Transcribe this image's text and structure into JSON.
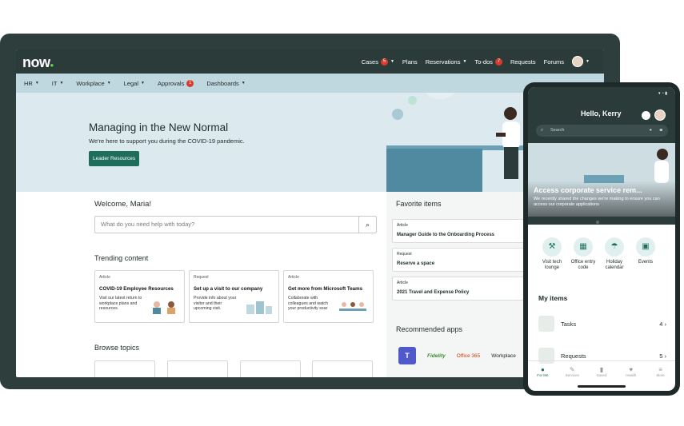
{
  "portal": {
    "logo": "now",
    "topnav": [
      {
        "label": "Cases",
        "badge": "5"
      },
      {
        "label": "Plans"
      },
      {
        "label": "Reservations"
      },
      {
        "label": "To-dos",
        "badge": "7"
      },
      {
        "label": "Requests"
      },
      {
        "label": "Forums"
      }
    ],
    "subnav": [
      {
        "label": "HR"
      },
      {
        "label": "IT"
      },
      {
        "label": "Workplace"
      },
      {
        "label": "Legal"
      },
      {
        "label": "Approvals",
        "badge": "1"
      },
      {
        "label": "Dashboards"
      }
    ],
    "hero": {
      "title": "Managing in the New Normal",
      "subtitle": "We're here to support you during the COVID-19 pandemic.",
      "button": "Leader Resources"
    },
    "welcome": "Welcome, Maria!",
    "search_placeholder": "What do you need help with today?",
    "trending_title": "Trending content",
    "trending": [
      {
        "type": "Article",
        "title": "COVID-19 Employee Resources",
        "desc": "Visit our latest return to workplace plans and resources."
      },
      {
        "type": "Request",
        "title": "Set up a visit to our company",
        "desc": "Provide info about your visitor and their upcoming visit."
      },
      {
        "type": "Article",
        "title": "Get more from Microsoft Teams",
        "desc": "Collaborate with colleagues and watch your productivity soar"
      }
    ],
    "browse_title": "Browse topics",
    "favorites_title": "Favorite items",
    "favorites": [
      {
        "type": "Article",
        "title": "Manager Guide to the Onboarding Process"
      },
      {
        "type": "Request",
        "title": "Reserve a space"
      },
      {
        "type": "Article",
        "title": "2021 Travel and Expense Policy"
      }
    ],
    "apps_title": "Recommended apps",
    "apps": [
      "Fidelity",
      "Office 365",
      "Workplace"
    ]
  },
  "mobile": {
    "greeting": "Hello, Kerry",
    "search_placeholder": "Search",
    "hero_title": "Access corporate service rem...",
    "hero_text": "We recently shared the changes we're making to ensure you can access our corporate applications",
    "quick": [
      {
        "label": "Visit tech lounge",
        "icon": "wrench-icon"
      },
      {
        "label": "Office entry code",
        "icon": "qr-icon"
      },
      {
        "label": "Holiday calendar",
        "icon": "umbrella-icon"
      },
      {
        "label": "Events",
        "icon": "calendar-icon"
      }
    ],
    "my_items_title": "My items",
    "items": [
      {
        "label": "Tasks",
        "count": "4"
      },
      {
        "label": "Requests",
        "count": "5"
      }
    ],
    "tabs": [
      {
        "label": "For Me",
        "active": true
      },
      {
        "label": "Services"
      },
      {
        "label": "Saved"
      },
      {
        "label": "Health"
      },
      {
        "label": "More"
      }
    ]
  },
  "colors": {
    "dark": "#2a3b3a",
    "accent": "#1f6e5b",
    "badge": "#d93a2b",
    "subnav": "#bfd8df"
  }
}
